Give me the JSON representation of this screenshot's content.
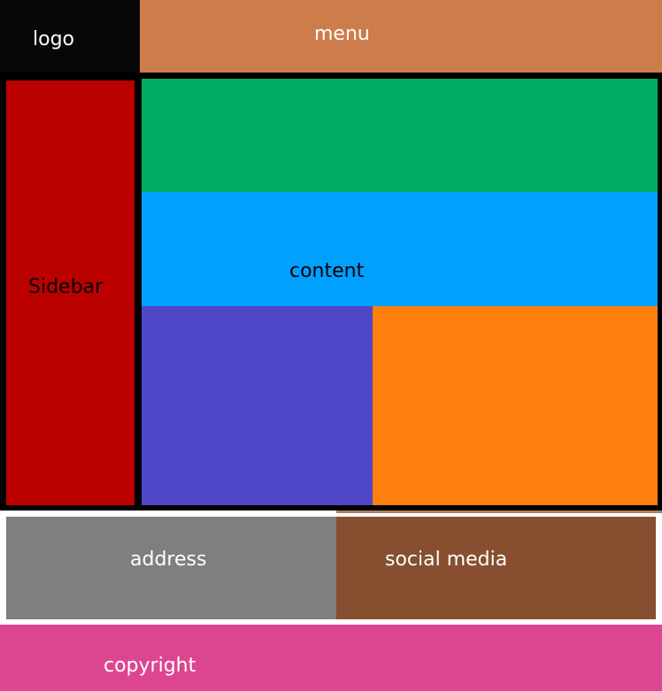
{
  "colors": {
    "logo": "#070707",
    "menu": "#cd7c4b",
    "sidebar": "#bb0000",
    "content_green": "#00ae63",
    "content_blue": "#00a0ff",
    "content_purple": "#5047c8",
    "content_orange": "#ff7f0e",
    "address": "#7f7f7f",
    "social_media": "#874f2f",
    "footer_shadow": "#b08060",
    "copyright": "#dc4690",
    "light_text": "#ffffff",
    "dark_text": "#000000"
  },
  "labels": {
    "logo": "logo",
    "menu": "menu",
    "sidebar": "Sidebar",
    "content": "content",
    "address": "address",
    "social_media": "social media",
    "copyright": "copyright"
  }
}
